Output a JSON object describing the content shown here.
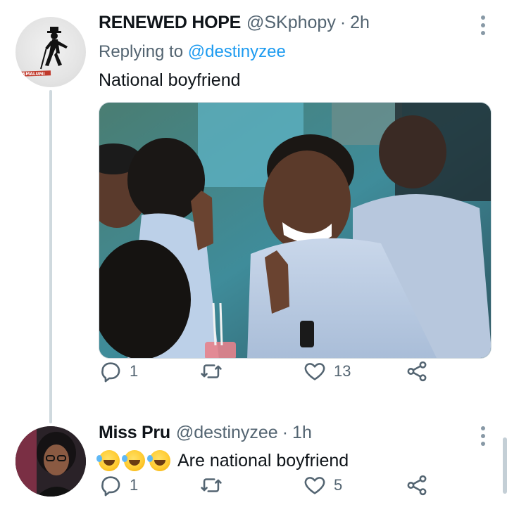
{
  "tweets": [
    {
      "name": "RENEWED HOPE",
      "handle": "@SKphopy",
      "separator": "·",
      "time": "2h",
      "replying_prefix": "Replying to ",
      "replying_to": "@destinyzee",
      "text": "National boyfriend",
      "avatar_logo_text": "SMALUMI",
      "stats": {
        "replies": "1",
        "retweets": "",
        "likes": "13"
      }
    },
    {
      "name": "Miss Pru",
      "handle": "@destinyzee",
      "separator": "·",
      "time": "1h",
      "emojis": [
        "rolling-on-floor-laughing",
        "rolling-on-floor-laughing",
        "rolling-on-floor-laughing"
      ],
      "text": "Are national boyfriend",
      "stats": {
        "replies": "1",
        "retweets": "",
        "likes": "5"
      }
    }
  ],
  "icons": {
    "reply": "reply-icon",
    "retweet": "retweet-icon",
    "like": "heart-icon",
    "share": "share-icon",
    "more": "more-options-icon"
  },
  "colors": {
    "text": "#0f1419",
    "muted": "#536471",
    "link": "#1d9bf0",
    "divider": "#cfd9de"
  }
}
